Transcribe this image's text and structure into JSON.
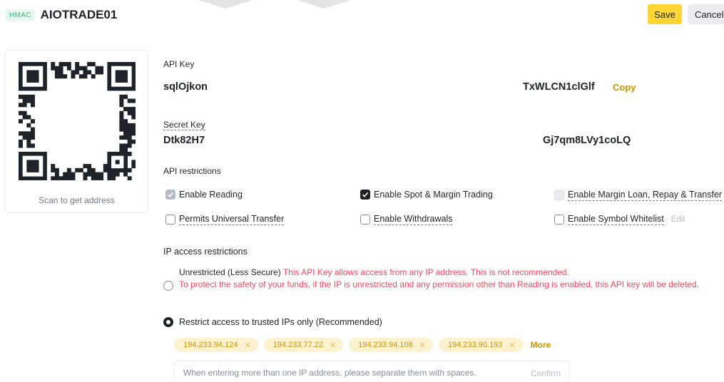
{
  "header": {
    "badge": "HMAC",
    "title": "AIOTRADE01",
    "save_label": "Save",
    "cancel_label": "Cancel"
  },
  "qr": {
    "caption": "Scan to get address"
  },
  "api_key": {
    "label": "API Key",
    "value_start": "sqlOjkon",
    "value_end": "TxWLCN1clGlf",
    "copy_label": "Copy"
  },
  "secret_key": {
    "label": "Secret Key",
    "value_start": "Dtk82H7",
    "value_end": "Gj7qm8LVy1coLQ"
  },
  "restrictions": {
    "title": "API restrictions",
    "permissions": [
      {
        "label": "Enable Reading",
        "state": "checked-grey"
      },
      {
        "label": "Enable Spot & Margin Trading",
        "state": "checked"
      },
      {
        "label": "Enable Margin Loan, Repay & Transfer",
        "state": "disabled"
      },
      {
        "label": "Permits Universal Transfer",
        "state": "unchecked"
      },
      {
        "label": "Enable Withdrawals",
        "state": "unchecked"
      },
      {
        "label": "Enable Symbol Whitelist",
        "state": "unchecked",
        "extra": "Edit"
      }
    ]
  },
  "ip_access": {
    "title": "IP access restrictions",
    "unrestricted_label": "Unrestricted (Less Secure)",
    "unrestricted_warning_1": "This API Key allows access from any IP address. This is not recommended.",
    "unrestricted_warning_2": "To protect the safety of your funds, if the IP is unrestricted and any permission other than Reading is enabled, this API key will be deleted.",
    "restricted_label": "Restrict access to trusted IPs only (Recommended)",
    "selected": "restricted",
    "ips": [
      "194.233.94.124",
      "194.233.77.22",
      "194.233.94.108",
      "194.233.90.193"
    ],
    "more_label": "More",
    "input_placeholder": "When entering more than one IP address, please separate them with spaces.",
    "confirm_label": "Confirm"
  },
  "colors": {
    "accent": "#fcd535",
    "link": "#c99400",
    "danger": "#f6465d",
    "badge_green": "#2ebd85"
  }
}
